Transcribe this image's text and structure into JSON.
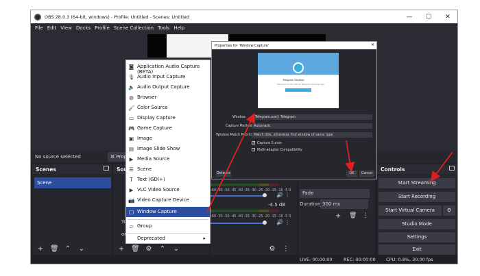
{
  "window": {
    "title": "OBS 28.0.3 (64-bit, windows) - Profile: Untitled - Scenes: Untitled",
    "minimize_icon": "minimize-icon",
    "maximize_icon": "maximize-icon",
    "close_icon": "close-icon"
  },
  "menu": [
    "File",
    "Edit",
    "View",
    "Docks",
    "Profile",
    "Scene Collection",
    "Tools",
    "Help"
  ],
  "source_bar": {
    "no_source": "No source selected",
    "properties": "Prop"
  },
  "scenes": {
    "title": "Scenes",
    "items": [
      "Scene"
    ]
  },
  "sources_partial_title": "Sou",
  "context_menu": {
    "items": [
      {
        "label": "Application Audio Capture (BETA)",
        "icon": "app-audio-icon"
      },
      {
        "label": "Audio Input Capture",
        "icon": "microphone-icon"
      },
      {
        "label": "Audio Output Capture",
        "icon": "speaker-icon"
      },
      {
        "label": "Browser",
        "icon": "globe-icon"
      },
      {
        "label": "Color Source",
        "icon": "brush-icon"
      },
      {
        "label": "Display Capture",
        "icon": "monitor-icon"
      },
      {
        "label": "Game Capture",
        "icon": "gamepad-icon"
      },
      {
        "label": "Image",
        "icon": "image-icon"
      },
      {
        "label": "Image Slide Show",
        "icon": "slideshow-icon"
      },
      {
        "label": "Media Source",
        "icon": "play-icon"
      },
      {
        "label": "Scene",
        "icon": "list-icon"
      },
      {
        "label": "Text (GDI+)",
        "icon": "text-icon"
      },
      {
        "label": "VLC Video Source",
        "icon": "vlc-play-icon"
      },
      {
        "label": "Video Capture Device",
        "icon": "camera-icon"
      },
      {
        "label": "Window Capture",
        "icon": "window-icon"
      },
      {
        "label": "Group",
        "icon": "folder-icon"
      },
      {
        "label": "Deprecated",
        "icon": "submenu-arrow-icon"
      }
    ],
    "selected": "Window Capture"
  },
  "mixer": {
    "scale": [
      "-60",
      "-55",
      "-50",
      "-45",
      "-40",
      "-35",
      "-30",
      "-25",
      "-20",
      "-15",
      "-10",
      "-5",
      "0"
    ],
    "level2": "-4.5 dB",
    "partial_labels": [
      "Yo",
      "or"
    ]
  },
  "transitions": {
    "duration_label": "Duration",
    "duration_value": "300 ms",
    "fade": "Fade"
  },
  "controls": {
    "title": "Controls",
    "buttons": [
      "Start Streaming",
      "Start Recording",
      "Start Virtual Camera",
      "Studio Mode",
      "Settings",
      "Exit"
    ]
  },
  "status": {
    "live": "LIVE: 00:00:00",
    "rec": "REC: 00:00:00",
    "cpu": "CPU: 0.8%, 30.00 fps"
  },
  "dialog": {
    "title": "Properties for 'Window Capture'",
    "preview_text1": "Telegram Desktop",
    "preview_text2": "Welcome to the official Telegram Desktop app",
    "window_label": "Window",
    "window_value": "[Telegram.exe]: Telegram",
    "capture_method_label": "Capture Method",
    "capture_method_value": "Automatic",
    "match_priority_label": "Window Match Priority",
    "match_priority_value": "Match title, otherwise find window of same type",
    "capture_cursor": "Capture Cursor",
    "multiadapter": "Multi-adapter Compatibility",
    "defaults": "Defaults",
    "ok": "OK",
    "cancel": "Cancel"
  }
}
